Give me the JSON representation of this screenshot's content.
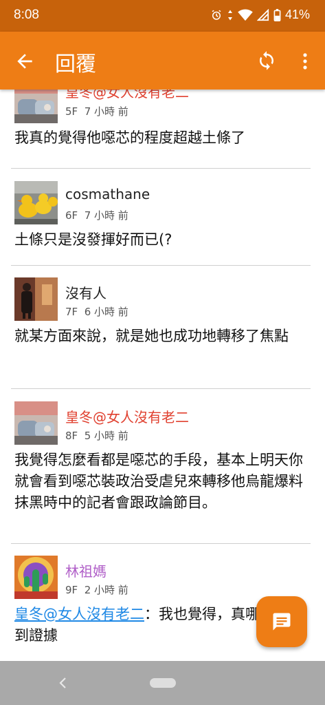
{
  "status_bar": {
    "time": "8:08",
    "battery": "41%"
  },
  "app_bar": {
    "title": "回覆",
    "back_icon": "arrow-left-icon",
    "refresh_icon": "refresh-icon",
    "more_icon": "more-vert-icon"
  },
  "colors": {
    "accent": "#ee7d15",
    "status_bar": "#c7620b",
    "author_red": "#e0402f",
    "author_purple": "#b05fc8",
    "link_blue": "#1e88e5"
  },
  "posts": [
    {
      "author": "皇冬@女人沒有老二",
      "floor": "5F",
      "time": "7 小時 前",
      "body": "我真的覺得他噁芯的程度超越土條了"
    },
    {
      "author": "cosmathane",
      "floor": "6F",
      "time": "7 小時 前",
      "body": "土條只是沒發揮好而已(?"
    },
    {
      "author": "沒有人",
      "floor": "7F",
      "time": "6 小時 前",
      "body": "就某方面來說，就是她也成功地轉移了焦點"
    },
    {
      "author": "皇冬@女人沒有老二",
      "floor": "8F",
      "time": "5 小時 前",
      "body": "我覺得怎麼看都是噁芯的手段，基本上明天你就會看到噁芯裝政治受虐兒來轉移他烏龍爆料抹黑時中的記者會跟政論節目。"
    },
    {
      "author": "林祖媽",
      "floor": "9F",
      "time": "2 小時 前",
      "mention": "皇冬@女人沒有老二",
      "body": "：我也覺得，真哪天能找到證據"
    }
  ],
  "fab": {
    "icon": "comment-icon"
  }
}
